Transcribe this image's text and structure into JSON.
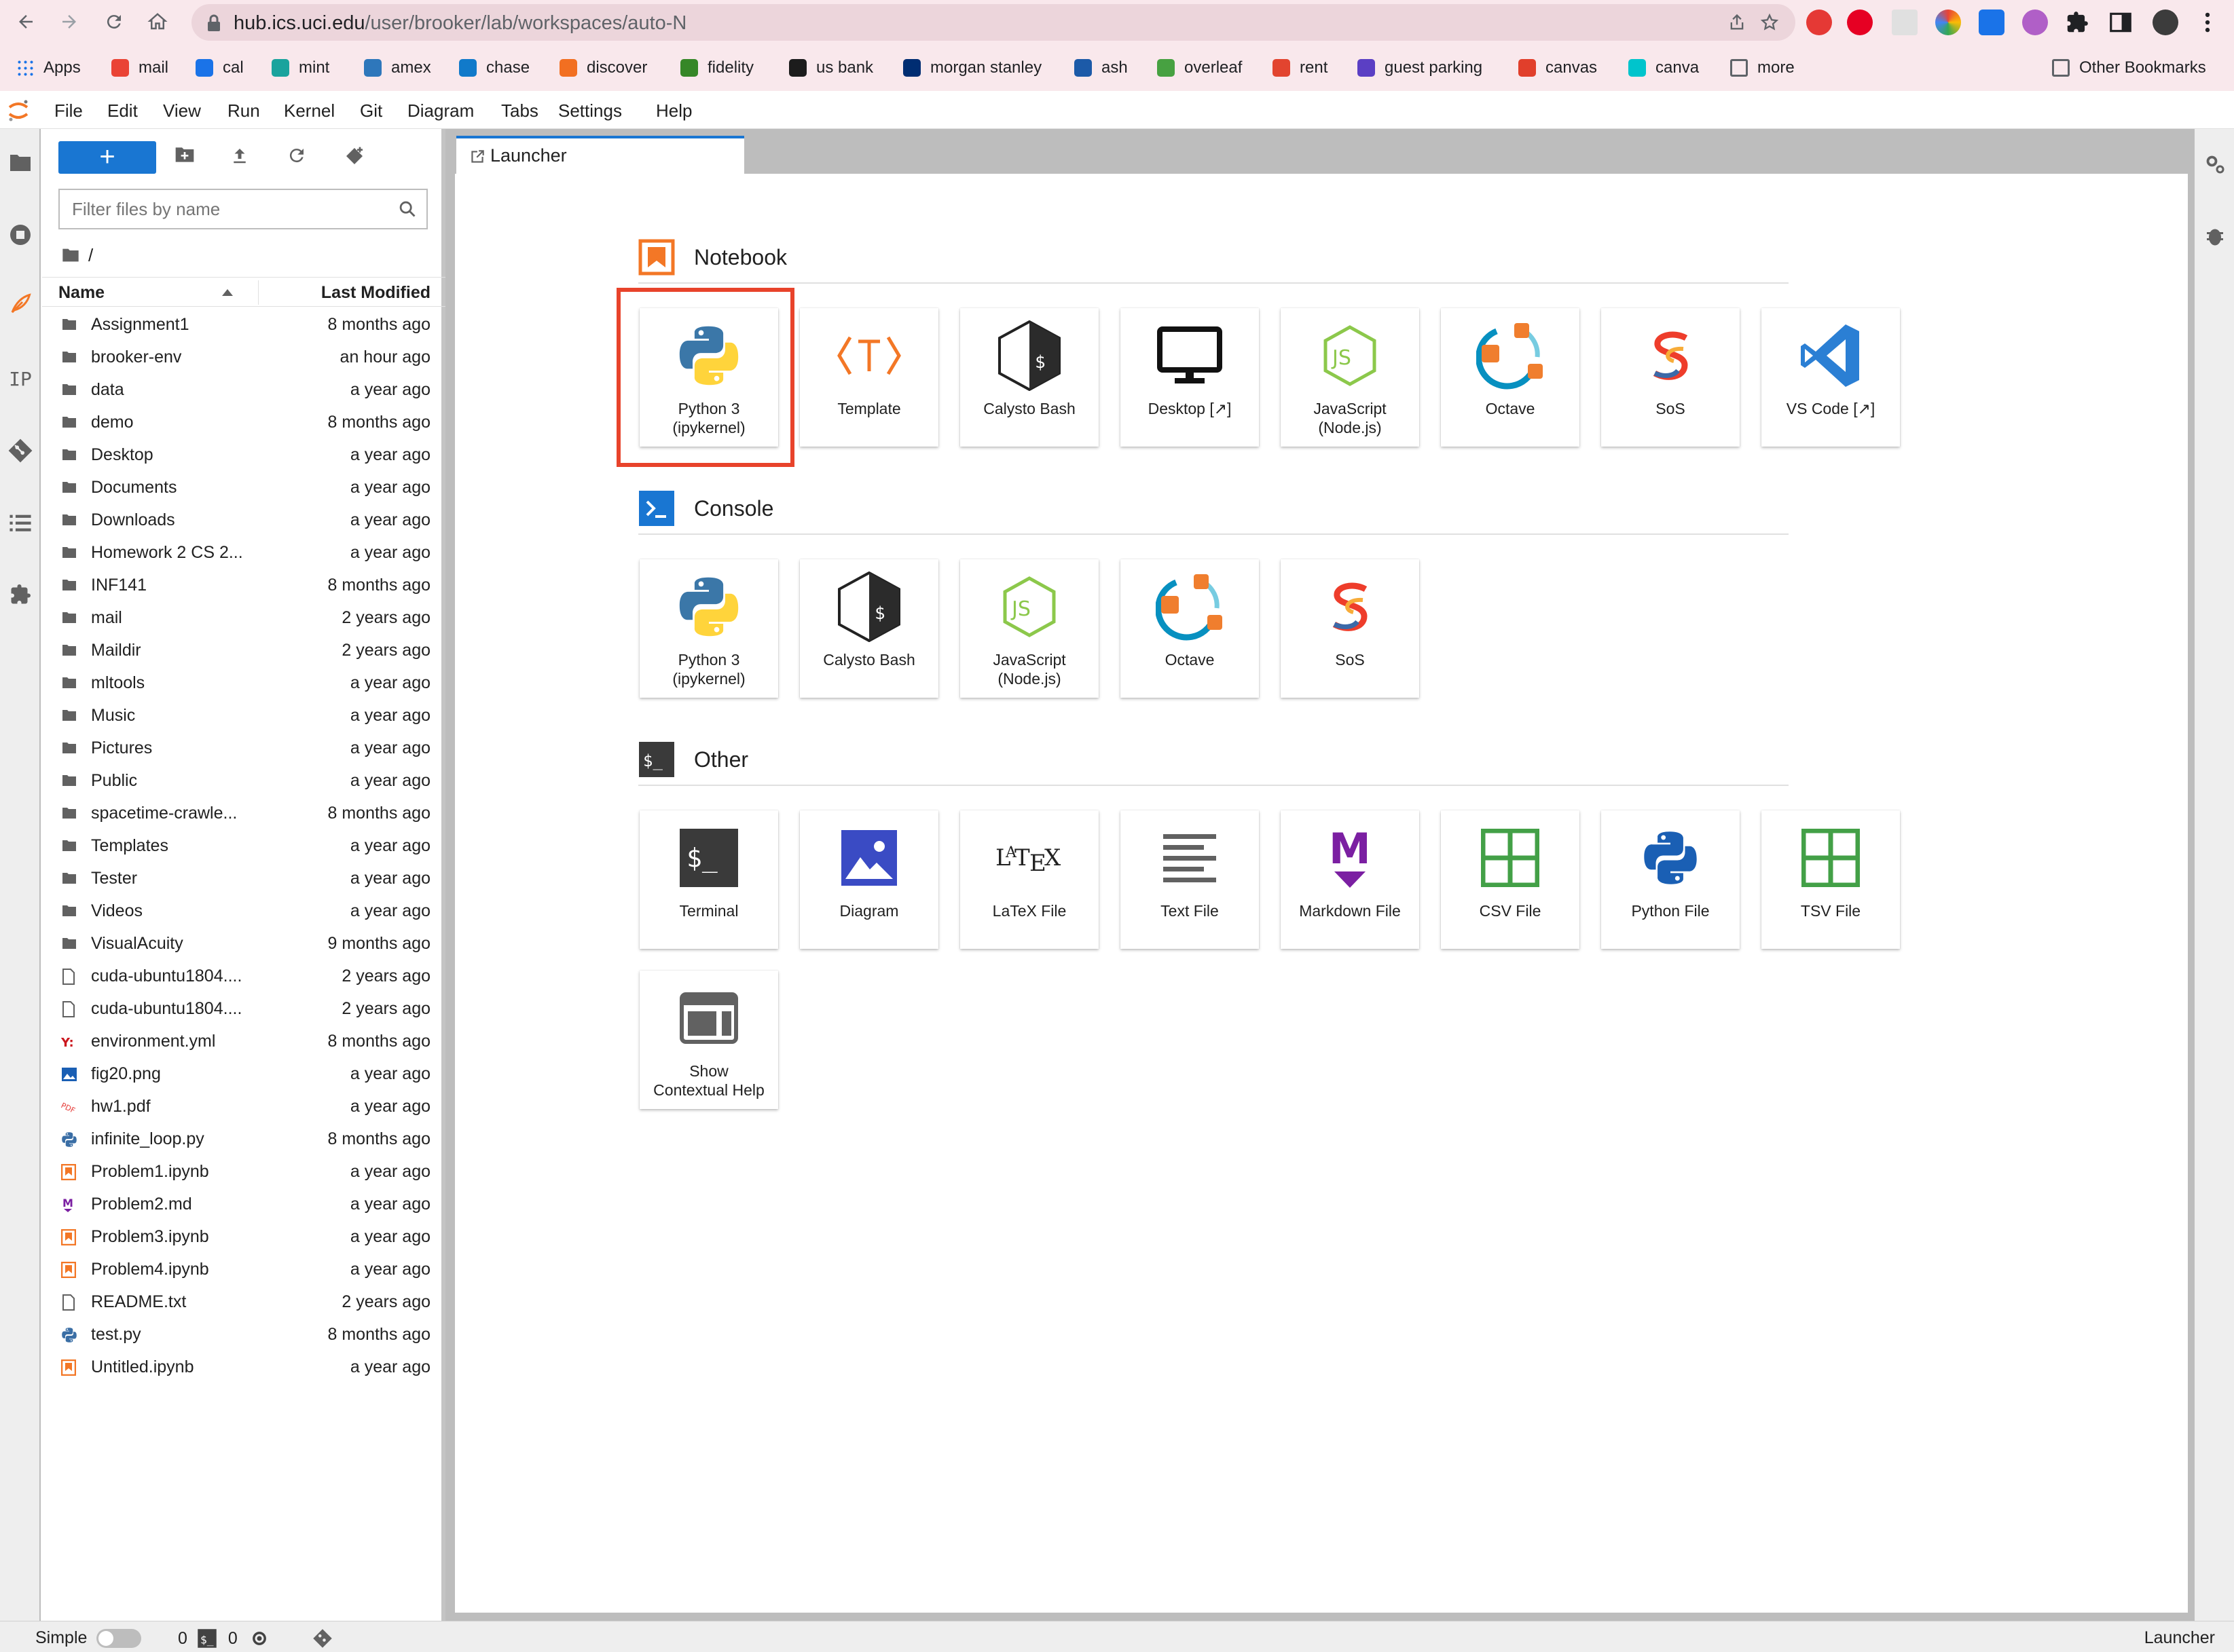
{
  "browser": {
    "url_host": "hub.ics.uci.edu",
    "url_path": "/user/brooker/lab/workspaces/auto-N",
    "bookmarks": [
      {
        "label": "Apps",
        "icon": "apps-grid-icon",
        "color": "#1a73e8"
      },
      {
        "label": "mail",
        "icon": "gmail-icon",
        "color": "#ea4335"
      },
      {
        "label": "cal",
        "icon": "calendar-icon",
        "color": "#1a73e8"
      },
      {
        "label": "mint",
        "icon": "mint-icon",
        "color": "#1aa39d"
      },
      {
        "label": "amex",
        "icon": "amex-icon",
        "color": "#2e77bb"
      },
      {
        "label": "chase",
        "icon": "chase-icon",
        "color": "#117aca"
      },
      {
        "label": "discover",
        "icon": "discover-icon",
        "color": "#f26f21"
      },
      {
        "label": "fidelity",
        "icon": "fidelity-icon",
        "color": "#368727"
      },
      {
        "label": "us bank",
        "icon": "usbank-icon",
        "color": "#1c1c1c"
      },
      {
        "label": "morgan stanley",
        "icon": "morgan-stanley-icon",
        "color": "#002d72"
      },
      {
        "label": "ash",
        "icon": "ash-icon",
        "color": "#1c5aa8"
      },
      {
        "label": "overleaf",
        "icon": "overleaf-icon",
        "color": "#47a141"
      },
      {
        "label": "rent",
        "icon": "rent-icon",
        "color": "#e2442f"
      },
      {
        "label": "guest parking",
        "icon": "parking-icon",
        "color": "#5b3fc4"
      },
      {
        "label": "canvas",
        "icon": "canvas-icon",
        "color": "#e13f2b"
      },
      {
        "label": "canva",
        "icon": "canva-icon",
        "color": "#00c4cc"
      },
      {
        "label": "more",
        "icon": "folder-icon",
        "color": "#5f6368"
      }
    ],
    "other_bookmarks": "Other Bookmarks"
  },
  "menu": [
    "File",
    "Edit",
    "View",
    "Run",
    "Kernel",
    "Git",
    "Diagram",
    "Tabs",
    "Settings",
    "Help"
  ],
  "filebrowser": {
    "new_label": "+",
    "filter_placeholder": "Filter files by name",
    "path": "/",
    "col_name": "Name",
    "col_modified": "Last Modified",
    "files": [
      {
        "name": "Assignment1",
        "modified": "8 months ago",
        "type": "folder"
      },
      {
        "name": "brooker-env",
        "modified": "an hour ago",
        "type": "folder"
      },
      {
        "name": "data",
        "modified": "a year ago",
        "type": "folder"
      },
      {
        "name": "demo",
        "modified": "8 months ago",
        "type": "folder"
      },
      {
        "name": "Desktop",
        "modified": "a year ago",
        "type": "folder"
      },
      {
        "name": "Documents",
        "modified": "a year ago",
        "type": "folder"
      },
      {
        "name": "Downloads",
        "modified": "a year ago",
        "type": "folder"
      },
      {
        "name": "Homework 2 CS 2...",
        "modified": "a year ago",
        "type": "folder"
      },
      {
        "name": "INF141",
        "modified": "8 months ago",
        "type": "folder"
      },
      {
        "name": "mail",
        "modified": "2 years ago",
        "type": "folder"
      },
      {
        "name": "Maildir",
        "modified": "2 years ago",
        "type": "folder"
      },
      {
        "name": "mltools",
        "modified": "a year ago",
        "type": "folder"
      },
      {
        "name": "Music",
        "modified": "a year ago",
        "type": "folder"
      },
      {
        "name": "Pictures",
        "modified": "a year ago",
        "type": "folder"
      },
      {
        "name": "Public",
        "modified": "a year ago",
        "type": "folder"
      },
      {
        "name": "spacetime-crawle...",
        "modified": "8 months ago",
        "type": "folder"
      },
      {
        "name": "Templates",
        "modified": "a year ago",
        "type": "folder"
      },
      {
        "name": "Tester",
        "modified": "a year ago",
        "type": "folder"
      },
      {
        "name": "Videos",
        "modified": "a year ago",
        "type": "folder"
      },
      {
        "name": "VisualAcuity",
        "modified": "9 months ago",
        "type": "folder"
      },
      {
        "name": "cuda-ubuntu1804....",
        "modified": "2 years ago",
        "type": "file"
      },
      {
        "name": "cuda-ubuntu1804....",
        "modified": "2 years ago",
        "type": "file"
      },
      {
        "name": "environment.yml",
        "modified": "8 months ago",
        "type": "yaml"
      },
      {
        "name": "fig20.png",
        "modified": "a year ago",
        "type": "image"
      },
      {
        "name": "hw1.pdf",
        "modified": "a year ago",
        "type": "pdf"
      },
      {
        "name": "infinite_loop.py",
        "modified": "8 months ago",
        "type": "python"
      },
      {
        "name": "Problem1.ipynb",
        "modified": "a year ago",
        "type": "notebook"
      },
      {
        "name": "Problem2.md",
        "modified": "a year ago",
        "type": "markdown"
      },
      {
        "name": "Problem3.ipynb",
        "modified": "a year ago",
        "type": "notebook"
      },
      {
        "name": "Problem4.ipynb",
        "modified": "a year ago",
        "type": "notebook"
      },
      {
        "name": "README.txt",
        "modified": "2 years ago",
        "type": "file"
      },
      {
        "name": "test.py",
        "modified": "8 months ago",
        "type": "python"
      },
      {
        "name": "Untitled.ipynb",
        "modified": "a year ago",
        "type": "notebook"
      }
    ]
  },
  "tab": {
    "label": "Launcher"
  },
  "launcher": {
    "sections": [
      {
        "title": "Notebook",
        "icon": "notebook-icon",
        "cards": [
          {
            "label": "Python 3\n(ipykernel)",
            "icon": "python-icon"
          },
          {
            "label": "Template",
            "icon": "template-icon"
          },
          {
            "label": "Calysto Bash",
            "icon": "calysto-bash-icon"
          },
          {
            "label": "Desktop [↗]",
            "icon": "desktop-icon"
          },
          {
            "label": "JavaScript\n(Node.js)",
            "icon": "nodejs-icon"
          },
          {
            "label": "Octave",
            "icon": "octave-icon"
          },
          {
            "label": "SoS",
            "icon": "sos-icon"
          },
          {
            "label": "VS Code [↗]",
            "icon": "vscode-icon"
          }
        ]
      },
      {
        "title": "Console",
        "icon": "console-icon",
        "cards": [
          {
            "label": "Python 3\n(ipykernel)",
            "icon": "python-icon"
          },
          {
            "label": "Calysto Bash",
            "icon": "calysto-bash-icon"
          },
          {
            "label": "JavaScript\n(Node.js)",
            "icon": "nodejs-icon"
          },
          {
            "label": "Octave",
            "icon": "octave-icon"
          },
          {
            "label": "SoS",
            "icon": "sos-icon"
          }
        ]
      },
      {
        "title": "Other",
        "icon": "terminal-section-icon",
        "cards": [
          {
            "label": "Terminal",
            "icon": "terminal-icon"
          },
          {
            "label": "Diagram",
            "icon": "diagram-icon"
          },
          {
            "label": "LaTeX File",
            "icon": "latex-icon"
          },
          {
            "label": "Text File",
            "icon": "text-file-icon"
          },
          {
            "label": "Markdown File",
            "icon": "markdown-icon"
          },
          {
            "label": "CSV File",
            "icon": "csv-icon"
          },
          {
            "label": "Python File",
            "icon": "python-file-icon"
          },
          {
            "label": "TSV File",
            "icon": "tsv-icon"
          },
          {
            "label": "Show\nContextual Help",
            "icon": "contextual-help-icon"
          }
        ]
      }
    ]
  },
  "statusbar": {
    "simple_label": "Simple",
    "terminals_count": "0",
    "kernels_count": "0",
    "right_label": "Launcher"
  },
  "colors": {
    "accent": "#1976d2",
    "highlight": "#e8432b",
    "orange": "#f37726"
  }
}
